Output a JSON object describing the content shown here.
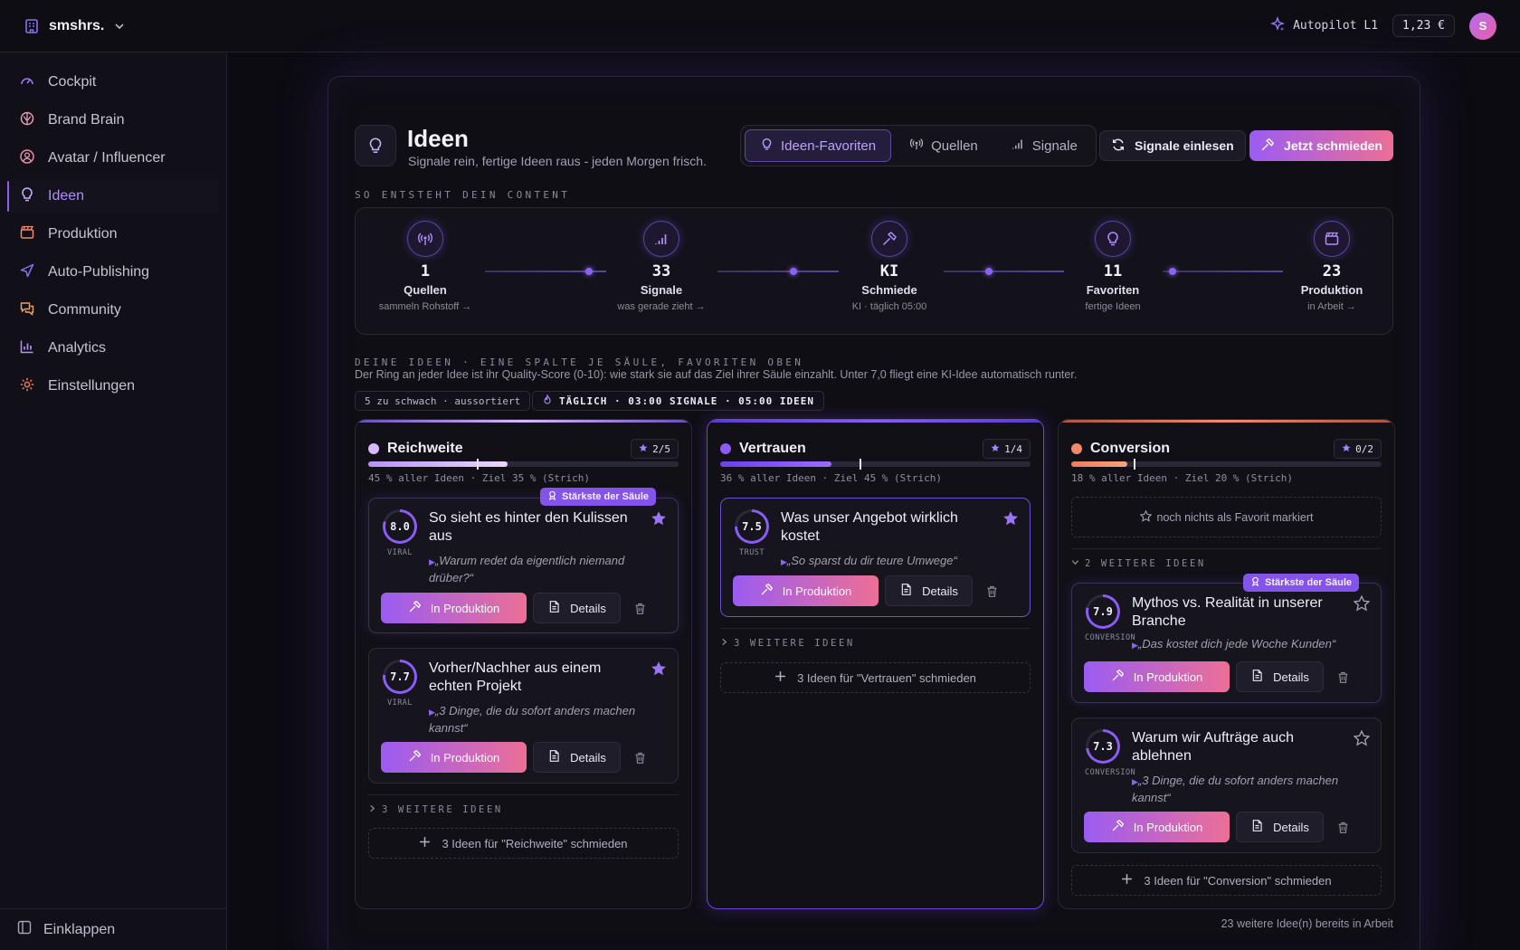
{
  "topbar": {
    "workspace_name": "smshrs.",
    "autopilot_label": "Autopilot L1",
    "credits": "1,23 €",
    "avatar_initial": "S"
  },
  "sidebar": {
    "items": [
      {
        "label": "Cockpit",
        "icon": "gauge-icon"
      },
      {
        "label": "Brand Brain",
        "icon": "brain-icon"
      },
      {
        "label": "Avatar / Influencer",
        "icon": "user-circle-icon"
      },
      {
        "label": "Ideen",
        "icon": "lightbulb-icon",
        "active": true
      },
      {
        "label": "Produktion",
        "icon": "clapperboard-icon"
      },
      {
        "label": "Auto-Publishing",
        "icon": "send-icon"
      },
      {
        "label": "Community",
        "icon": "chat-icon"
      },
      {
        "label": "Analytics",
        "icon": "bar-chart-icon"
      },
      {
        "label": "Einstellungen",
        "icon": "gear-icon"
      }
    ],
    "collapse_label": "Einklappen"
  },
  "header": {
    "title": "Ideen",
    "subtitle": "Signale rein, fertige Ideen raus - jeden Morgen frisch.",
    "tabs": [
      {
        "label": "Ideen-Favoriten",
        "active": true
      },
      {
        "label": "Quellen"
      },
      {
        "label": "Signale"
      }
    ],
    "btn_signals": "Signale einlesen",
    "btn_forge": "Jetzt schmieden"
  },
  "pipeline": {
    "label": "SO ENTSTEHT DEIN CONTENT",
    "stages": [
      {
        "value": "1",
        "label": "Quellen",
        "sub": "sammeln Rohstoff →"
      },
      {
        "value": "33",
        "label": "Signale",
        "sub": "was gerade zieht →"
      },
      {
        "value": "KI",
        "label": "Schmiede",
        "sub": "KI · täglich 05:00"
      },
      {
        "value": "11",
        "label": "Favoriten",
        "sub": "fertige Ideen"
      },
      {
        "value": "23",
        "label": "Produktion",
        "sub": "in Arbeit →"
      }
    ]
  },
  "ideas": {
    "label": "DEINE IDEEN · EINE SPALTE JE SÄULE, FAVORITEN OBEN",
    "description": "Der Ring an jeder Idee ist ihr Quality-Score (0-10): wie stark sie auf das Ziel ihrer Säule einzahlt. Unter 7,0 fliegt eine KI-Idee automatisch runter.",
    "pill_sorted": "5 zu schwach · aussortiert",
    "pill_schedule": "TÄGLICH · 03:00 SIGNALE · 05:00 IDEEN",
    "produce_label": "In Produktion",
    "details_label": "Details",
    "strongest_label": "Stärkste der Säule",
    "footer_note": "23 weitere Idee(n) bereits in Arbeit"
  },
  "columns": [
    {
      "name": "Reichweite",
      "favorites": "2/5",
      "share_pct": 45,
      "target_pct": 35,
      "caption": "45 % aller Ideen · Ziel 35 % (Strich)",
      "color": "#d9b8ff",
      "cards": [
        {
          "score": "8.0",
          "score_value": 8.0,
          "tag": "VIRAL",
          "title": "So sieht es hinter den Kulissen aus",
          "quote": "„Warum redet da eigentlich niemand drüber?“",
          "favorite": true,
          "strongest": true
        },
        {
          "score": "7.7",
          "score_value": 7.7,
          "tag": "VIRAL",
          "title": "Vorher/Nachher aus einem echten Projekt",
          "quote": "„3 Dinge, die du sofort anders machen kannst“",
          "favorite": true
        }
      ],
      "more": "3 WEITERE IDEEN",
      "forge": "3 Ideen für \"Reichweite\" schmieden"
    },
    {
      "name": "Vertrauen",
      "favorites": "1/4",
      "share_pct": 36,
      "target_pct": 45,
      "caption": "36 % aller Ideen · Ziel 45 % (Strich)",
      "color": "#8a5cf5",
      "cards": [
        {
          "score": "7.5",
          "score_value": 7.5,
          "tag": "TRUST",
          "title": "Was unser Angebot wirklich kostet",
          "quote": "„So sparst du dir teure Umwege“",
          "favorite": true
        }
      ],
      "more": "3 WEITERE IDEEN",
      "forge": "3 Ideen für \"Vertrauen\" schmieden"
    },
    {
      "name": "Conversion",
      "favorites": "0/2",
      "share_pct": 18,
      "target_pct": 20,
      "caption": "18 % aller Ideen · Ziel 20 % (Strich)",
      "color": "#f28a6a",
      "empty_favorites": "noch nichts als Favorit markiert",
      "more": "2 WEITERE IDEEN",
      "cards": [
        {
          "score": "7.9",
          "score_value": 7.9,
          "tag": "CONVERSION",
          "title": "Mythos vs. Realität in unserer Branche",
          "quote": "„Das kostet dich jede Woche Kunden“",
          "favorite": false,
          "strongest": true
        },
        {
          "score": "7.3",
          "score_value": 7.3,
          "tag": "CONVERSION",
          "title": "Warum wir Aufträge auch ablehnen",
          "quote": "„3 Dinge, die du sofort anders machen kannst“",
          "favorite": false
        }
      ],
      "forge": "3 Ideen für \"Conversion\" schmieden"
    }
  ]
}
